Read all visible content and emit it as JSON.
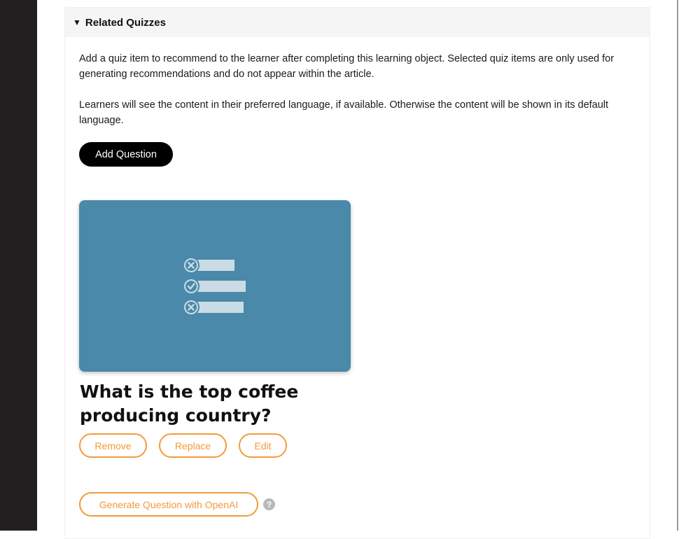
{
  "section": {
    "toggle_glyph": "▼",
    "title": "Related Quizzes"
  },
  "description": {
    "paragraph1": "Add a quiz item to recommend to the learner after completing this learning object. Selected quiz items are only used for generating recommendations and do not appear within the article.",
    "paragraph2": "Learners will see the content in their preferred language, if available. Otherwise the content will be shown in its default language."
  },
  "actions": {
    "add_question_label": "Add Question"
  },
  "quiz": {
    "icon": "quiz-list-icon",
    "title": "What is the top coffee producing country?",
    "remove_label": "Remove",
    "replace_label": "Replace",
    "edit_label": "Edit"
  },
  "generate": {
    "label": "Generate Question with OpenAI",
    "help_glyph": "?"
  },
  "colors": {
    "card_bg": "#4a89a9",
    "accent": "#f39a3b",
    "primary_button": "#000000"
  }
}
